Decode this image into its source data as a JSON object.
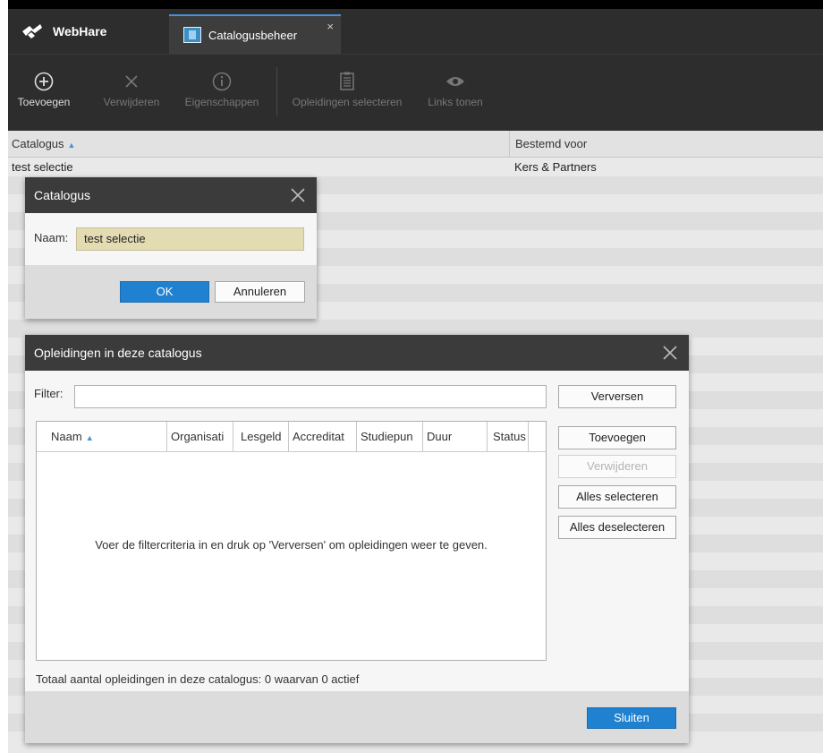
{
  "app": {
    "name": "WebHare",
    "active_tab": "Catalogusbeheer",
    "tab_close": "×"
  },
  "toolbar": {
    "buttons": [
      {
        "label": "Toevoegen",
        "icon": "add-circle-icon",
        "enabled": true
      },
      {
        "label": "Verwijderen",
        "icon": "x-icon",
        "enabled": false
      },
      {
        "label": "Eigenschappen",
        "icon": "info-circle-icon",
        "enabled": false
      },
      {
        "label": "Opleidingen selecteren",
        "icon": "clipboard-list-icon",
        "enabled": false
      },
      {
        "label": "Links tonen",
        "icon": "eye-icon",
        "enabled": false
      }
    ]
  },
  "grid": {
    "columns": [
      "Catalogus",
      "Bestemd voor"
    ],
    "rows": [
      {
        "catalogus": "test selectie",
        "bestemd_voor": "Kers & Partners"
      }
    ]
  },
  "catalogus_dialog": {
    "title": "Catalogus",
    "naam_label": "Naam:",
    "naam_value": "test selectie",
    "ok_label": "OK",
    "cancel_label": "Annuleren"
  },
  "opleidingen_dialog": {
    "title": "Opleidingen in deze catalogus",
    "filter_label": "Filter:",
    "filter_value": "",
    "columns": [
      "Naam",
      "Organisati",
      "Lesgeld",
      "Accreditat",
      "Studiepun",
      "Duur",
      "Status"
    ],
    "empty_message": "Voer de filtercriteria in en druk op 'Verversen' om opleidingen weer te geven.",
    "total_text": "Totaal aantal opleidingen in deze catalogus: 0 waarvan 0 actief",
    "buttons": {
      "verversen": "Verversen",
      "toevoegen": "Toevoegen",
      "verwijderen": "Verwijderen",
      "alles_selecteren": "Alles selecteren",
      "alles_deselecteren": "Alles deselecteren",
      "sluiten": "Sluiten"
    }
  },
  "colors": {
    "accent": "#1f81d0",
    "toolbar_bg": "#2d2d2d",
    "input_highlight": "#e3dcb3"
  }
}
